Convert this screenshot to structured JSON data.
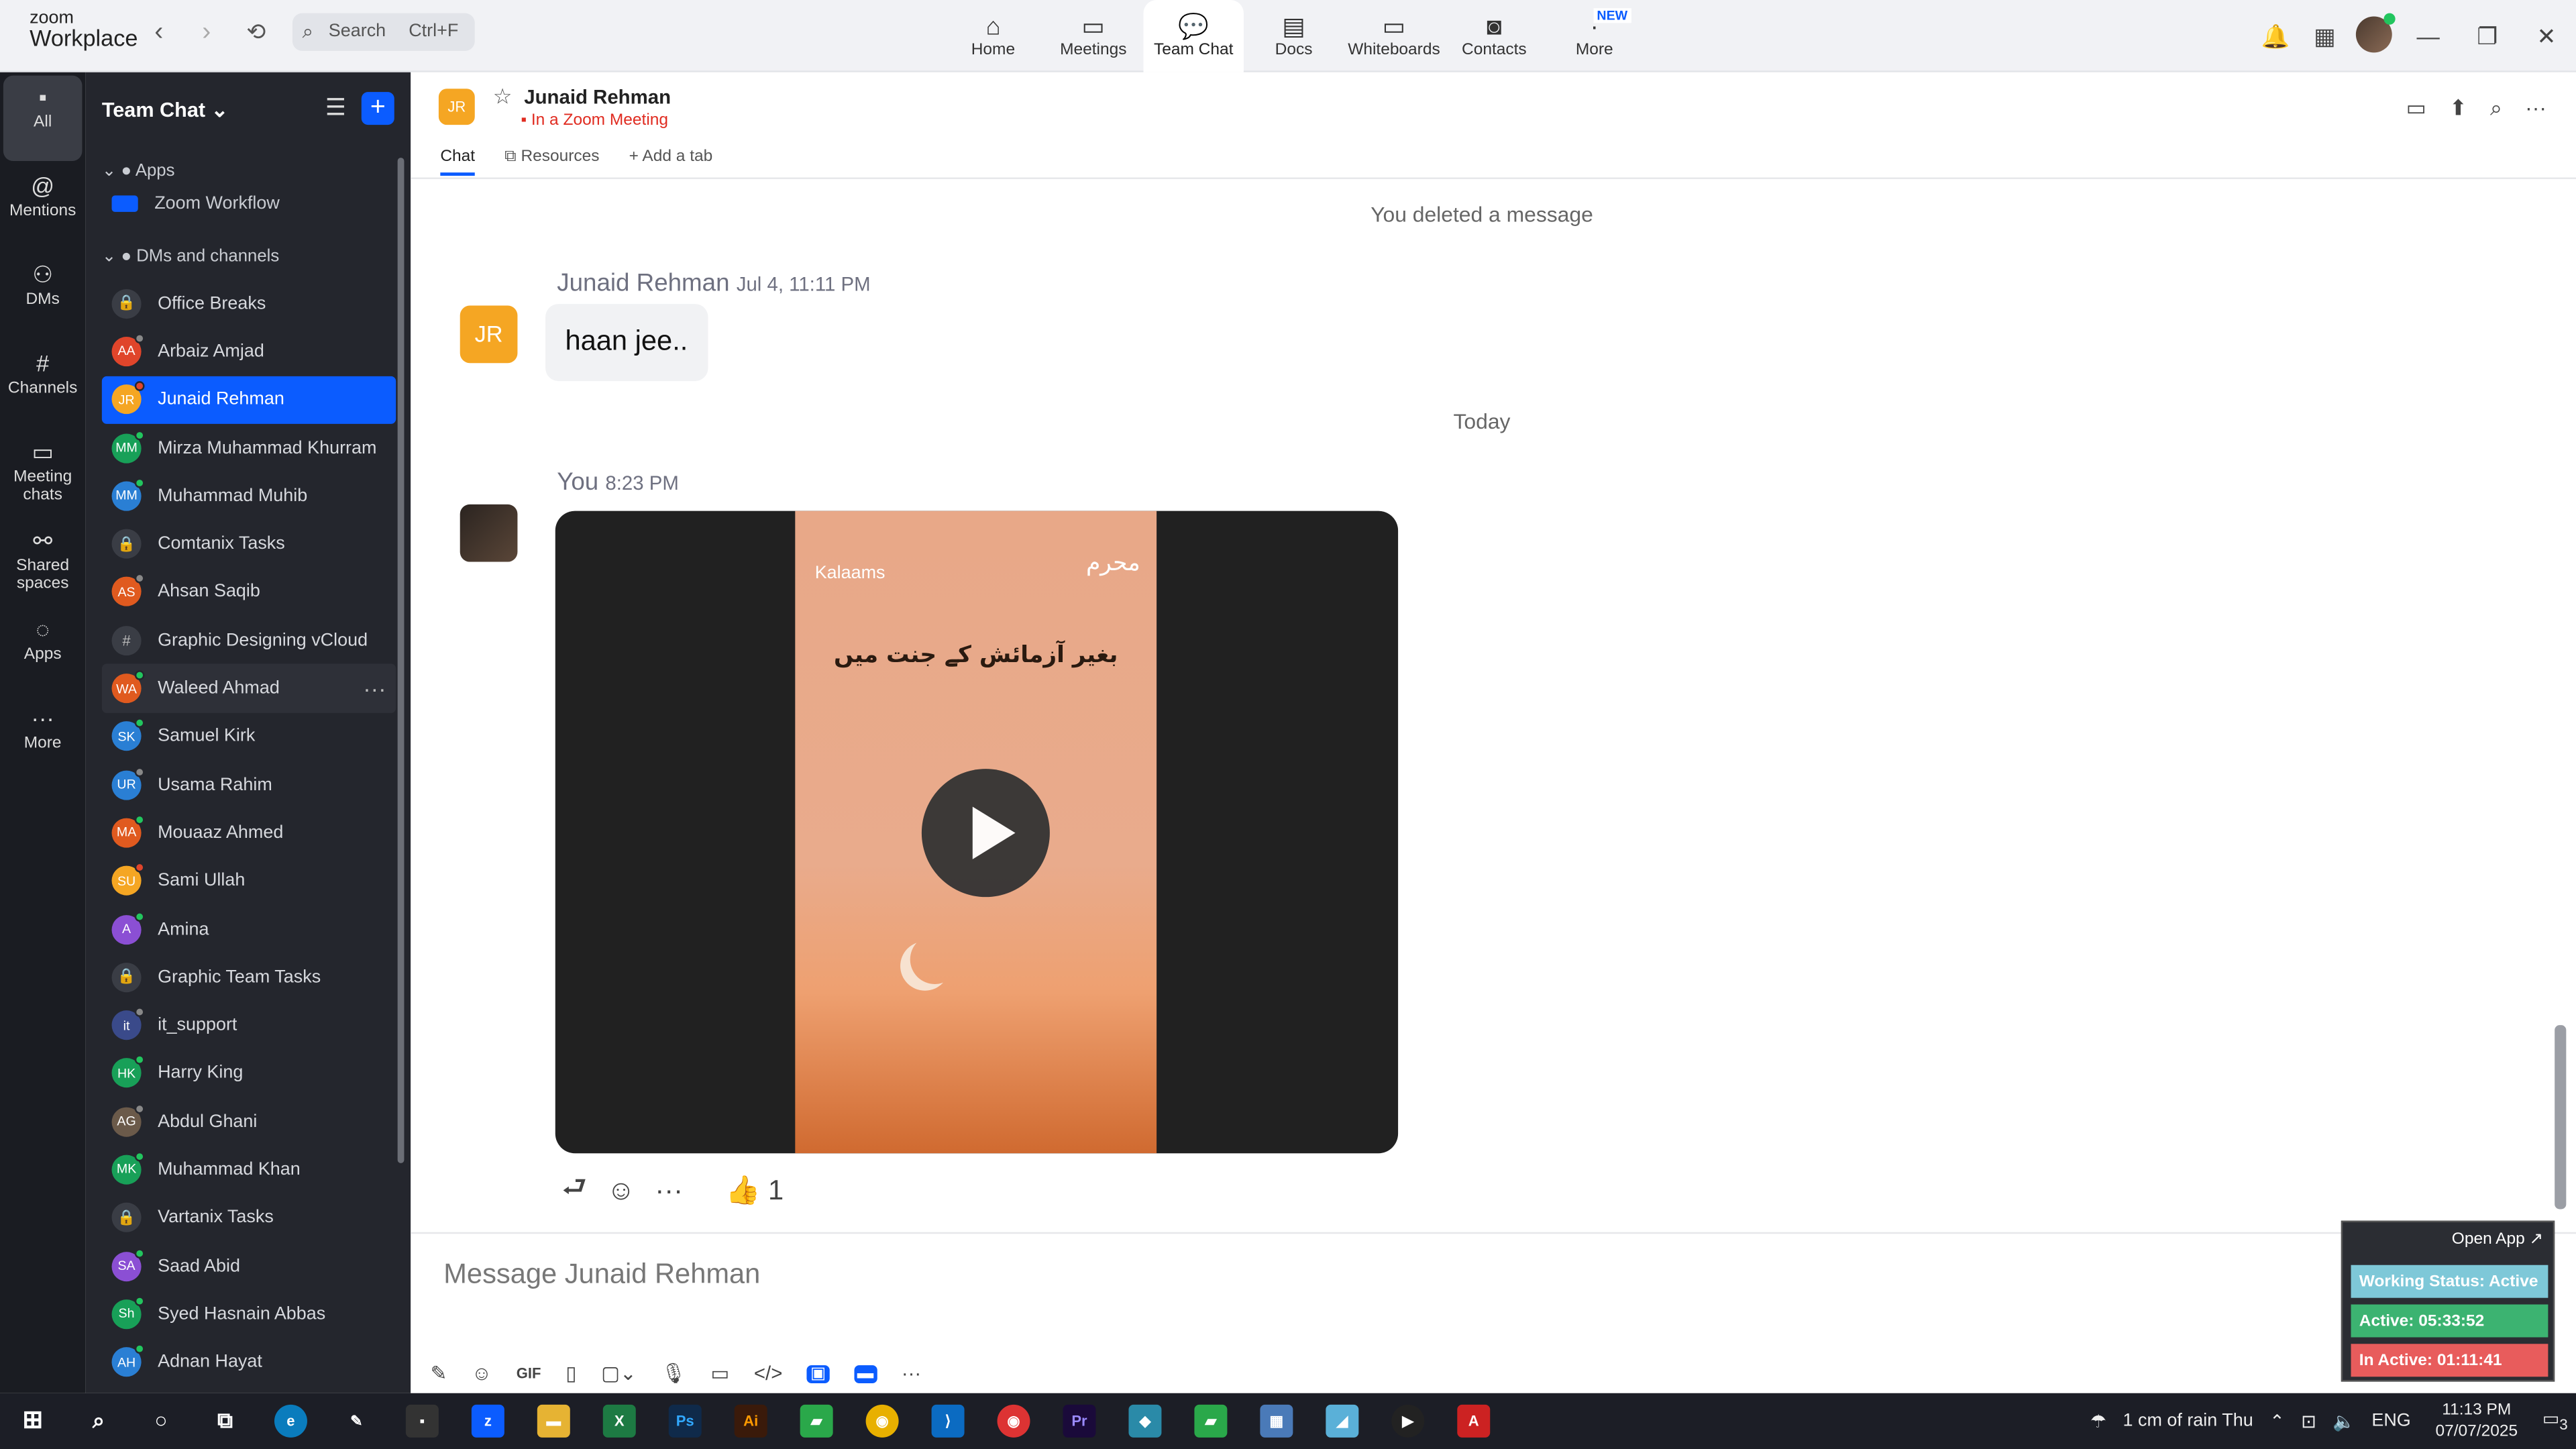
{
  "app": {
    "brand_top": "zoom",
    "brand_bottom": "Workplace"
  },
  "search": {
    "label": "Search",
    "shortcut": "Ctrl+F"
  },
  "nav_tabs": [
    {
      "label": "Home",
      "icon": "home-icon"
    },
    {
      "label": "Meetings",
      "icon": "video-camera-icon"
    },
    {
      "label": "Team Chat",
      "icon": "chat-icon",
      "active": true
    },
    {
      "label": "Docs",
      "icon": "docs-icon"
    },
    {
      "label": "Whiteboards",
      "icon": "whiteboard-icon"
    },
    {
      "label": "Contacts",
      "icon": "contacts-icon"
    },
    {
      "label": "More",
      "icon": "more-icon",
      "badge": "NEW"
    }
  ],
  "rail": [
    {
      "label": "All",
      "icon": "chat-bubble-icon"
    },
    {
      "label": "Mentions",
      "icon": "at-icon"
    },
    {
      "label": "DMs",
      "icon": "people-icon"
    },
    {
      "label": "Channels",
      "icon": "hash-icon"
    },
    {
      "label": "Meeting chats",
      "icon": "calendar-icon"
    },
    {
      "label": "Shared spaces",
      "icon": "shared-icon"
    },
    {
      "label": "Apps",
      "icon": "apps-icon"
    },
    {
      "label": "More",
      "icon": "ellipsis-icon"
    }
  ],
  "sidebar": {
    "title": "Team Chat",
    "apps_section": "Apps",
    "apps_item": "Zoom Workflow",
    "dms_section": "DMs and channels",
    "items": [
      {
        "label": "Office Breaks",
        "type": "lock"
      },
      {
        "label": "Arbaiz Amjad",
        "initials": "AA",
        "color": "#e0452b",
        "dot": "#888"
      },
      {
        "label": "Junaid Rehman",
        "initials": "JR",
        "color": "#f5a623",
        "dot": "#e0452b",
        "selected": true
      },
      {
        "label": "Mirza Muhammad Khurram",
        "initials": "MM",
        "color": "#18a058",
        "dot": "#22c55e"
      },
      {
        "label": "Muhammad Muhib",
        "initials": "MM",
        "color": "#2a7fd4",
        "dot": "#22c55e"
      },
      {
        "label": "Comtanix Tasks",
        "type": "lock"
      },
      {
        "label": "Ahsan Saqib",
        "initials": "AS",
        "color": "#e05a1f",
        "dot": "#888"
      },
      {
        "label": "Graphic Designing vCloud",
        "type": "hash"
      },
      {
        "label": "Waleed Ahmad",
        "initials": "WA",
        "color": "#e05a1f",
        "dot": "#22c55e",
        "hover": true
      },
      {
        "label": "Samuel Kirk",
        "initials": "SK",
        "color": "#2a7fd4",
        "dot": "#22c55e"
      },
      {
        "label": "Usama Rahim",
        "initials": "UR",
        "color": "#2a7fd4",
        "dot": "#888"
      },
      {
        "label": "Mouaaz Ahmed",
        "initials": "MA",
        "color": "#e05a1f",
        "dot": "#22c55e"
      },
      {
        "label": "Sami Ullah",
        "initials": "SU",
        "color": "#f5a623",
        "dot": "#e0452b"
      },
      {
        "label": "Amina",
        "initials": "A",
        "color": "#8b4fd4",
        "dot": "#22c55e"
      },
      {
        "label": "Graphic Team Tasks",
        "type": "lock"
      },
      {
        "label": "it_support",
        "initials": "it",
        "color": "#3a4a8a",
        "dot": "#888"
      },
      {
        "label": "Harry King",
        "initials": "HK",
        "color": "#18a058",
        "dot": "#22c55e"
      },
      {
        "label": "Abdul Ghani",
        "initials": "AG",
        "color": "#6b5a4a",
        "dot": "#888"
      },
      {
        "label": "Muhammad Khan",
        "initials": "MK",
        "color": "#18a058",
        "dot": "#22c55e"
      },
      {
        "label": "Vartanix Tasks",
        "type": "lock"
      },
      {
        "label": "Saad Abid",
        "initials": "SA",
        "color": "#8b4fd4",
        "dot": "#22c55e"
      },
      {
        "label": "Syed Hasnain Abbas",
        "initials": "Sh",
        "color": "#18a058",
        "dot": "#22c55e"
      },
      {
        "label": "Adnan Hayat",
        "initials": "AH",
        "color": "#2a7fd4",
        "dot": "#22c55e"
      }
    ]
  },
  "chat": {
    "avatar": "JR",
    "name": "Junaid Rehman",
    "status": "In a Zoom Meeting",
    "tabs": [
      "Chat",
      "Resources",
      "Add a tab"
    ],
    "system_deleted": "You deleted a message",
    "msg1": {
      "avatar": "JR",
      "sender": "Junaid Rehman",
      "time": "Jul 4, 11:11 PM",
      "text": "haan jee.."
    },
    "divider": "Today",
    "msg2": {
      "sender": "You",
      "time": "8:23 PM"
    },
    "video": {
      "logo": "Kalaams",
      "urdu_text": "بغیر آزمائش کے جنت میں",
      "arabic_badge": "محرم"
    },
    "reaction": {
      "emoji": "👍",
      "count": "1"
    },
    "composer_placeholder": "Message Junaid Rehman"
  },
  "widget": {
    "open": "Open App ↗",
    "working": {
      "label": "Working Status: Active",
      "color": "#7ec8d8"
    },
    "active": {
      "label": "Active: 05:33:52",
      "color": "#3cb371"
    },
    "inactive": {
      "label": "In Active: 01:11:41",
      "color": "#e85c5c"
    }
  },
  "taskbar": {
    "weather": "1 cm of rain Thu",
    "lang": "ENG",
    "time": "11:13 PM",
    "date": "07/07/2025",
    "notifications": "3"
  }
}
